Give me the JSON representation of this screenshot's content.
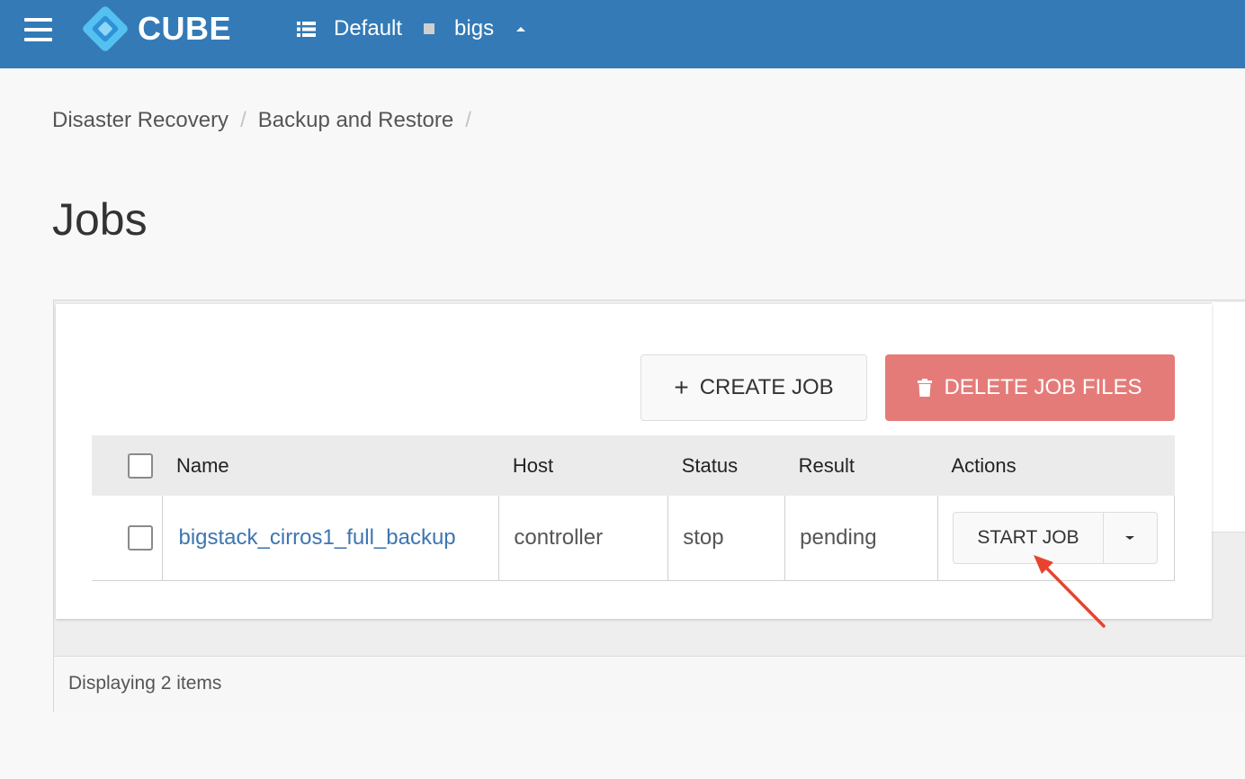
{
  "topbar": {
    "brand": "CUBE",
    "domain": "Default",
    "project": "bigs",
    "bg_color": "#337ab7"
  },
  "breadcrumb": {
    "items": [
      "Disaster Recovery",
      "Backup and Restore"
    ],
    "separator": "/"
  },
  "page": {
    "title": "Jobs"
  },
  "toolbar": {
    "create_label": "CREATE JOB",
    "delete_label": "DELETE JOB FILES",
    "delete_color": "#e57b78"
  },
  "table": {
    "columns": [
      "Name",
      "Host",
      "Status",
      "Result",
      "Actions"
    ],
    "rows": [
      {
        "name": "bigstack_cirros1_full_backup",
        "host": "controller",
        "status": "stop",
        "result": "pending",
        "action_label": "START JOB"
      }
    ]
  },
  "footer": {
    "text": "Displaying 2 items"
  },
  "icons": {
    "menu": "hamburger-menu-icon",
    "logo": "cube-logo-icon",
    "project_list": "list-icon",
    "project_marker": "square-icon",
    "project_dropdown": "caret-up-icon",
    "create": "plus-icon",
    "delete": "trash-icon",
    "row_actions": "caret-down-icon"
  },
  "annotation": {
    "arrow_color": "#e8432f"
  }
}
